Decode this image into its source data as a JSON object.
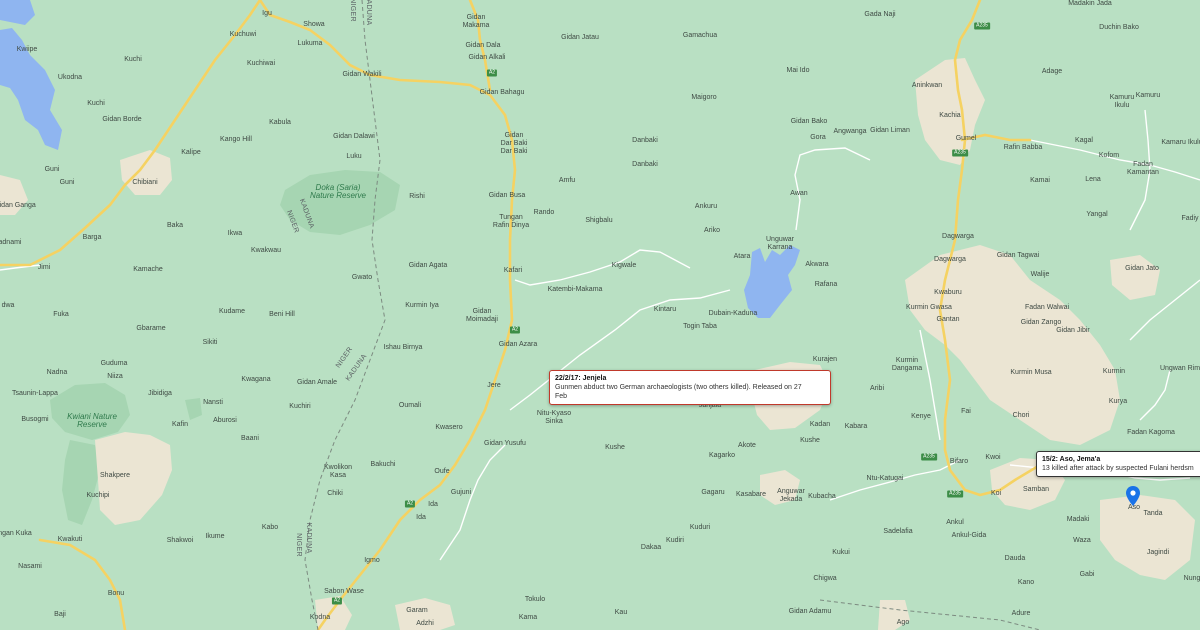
{
  "colors": {
    "land": "#b9e0c3",
    "forest": "#a6d5b2",
    "urban": "#ebe5d3",
    "water": "#8fb5f0",
    "highway": "#f5d262",
    "minor_road": "#ffffff",
    "accent": "#c0392b",
    "pin": "#1a73e8"
  },
  "places": [
    {
      "id": "showa",
      "name": "Showa"
    },
    {
      "id": "igu",
      "name": "Igu"
    },
    {
      "id": "lukuma",
      "name": "Lukuma"
    },
    {
      "id": "kuchuwi",
      "name": "Kuchuwi"
    },
    {
      "id": "kwiipe",
      "name": "Kwiipe"
    },
    {
      "id": "kuchi1",
      "name": "Kuchi"
    },
    {
      "id": "kuchiwai",
      "name": "Kuchiwai"
    },
    {
      "id": "gidan_wakili",
      "name": "Gidan Wakili"
    },
    {
      "id": "ukodna",
      "name": "Ukodna"
    },
    {
      "id": "kuchi2",
      "name": "Kuchi"
    },
    {
      "id": "gidan_borde",
      "name": "Gidan Borde"
    },
    {
      "id": "kabula",
      "name": "Kabula"
    },
    {
      "id": "kango_hill",
      "name": "Kango Hill"
    },
    {
      "id": "gidan_dalawi",
      "name": "Gidan Dalawi"
    },
    {
      "id": "kalipe",
      "name": "Kalipe"
    },
    {
      "id": "luku",
      "name": "Luku"
    },
    {
      "id": "chibiani",
      "name": "Chibiani"
    },
    {
      "id": "guni1",
      "name": "Guni"
    },
    {
      "id": "guni2",
      "name": "Guni"
    },
    {
      "id": "gidan_ganga",
      "name": "Gidan Ganga"
    },
    {
      "id": "rishi",
      "name": "Rishi"
    },
    {
      "id": "baka",
      "name": "Baka"
    },
    {
      "id": "barga",
      "name": "Barga"
    },
    {
      "id": "ikwa",
      "name": "Ikwa"
    },
    {
      "id": "adnami",
      "name": "adnami"
    },
    {
      "id": "kwakwau",
      "name": "Kwakwau"
    },
    {
      "id": "jimi",
      "name": "Jimi"
    },
    {
      "id": "kamache",
      "name": "Kamache"
    },
    {
      "id": "gwato",
      "name": "Gwato"
    },
    {
      "id": "gidan_agata",
      "name": "Gidan Agata"
    },
    {
      "id": "dwa",
      "name": "dwa"
    },
    {
      "id": "fuka",
      "name": "Fuka"
    },
    {
      "id": "kudame",
      "name": "Kudame"
    },
    {
      "id": "beni_hill",
      "name": "Beni Hill"
    },
    {
      "id": "kurmin_iya",
      "name": "Kurmin Iya"
    },
    {
      "id": "gbarame",
      "name": "Gbarame"
    },
    {
      "id": "sikiti",
      "name": "Sikiti"
    },
    {
      "id": "ishau_birnya",
      "name": "Ishau Birnya"
    },
    {
      "id": "guduma",
      "name": "Guduma"
    },
    {
      "id": "nadna",
      "name": "Nadna"
    },
    {
      "id": "niiza",
      "name": "Niiza"
    },
    {
      "id": "kwagana",
      "name": "Kwagana"
    },
    {
      "id": "gidan_amale",
      "name": "Gidan Amale"
    },
    {
      "id": "tsaunin_lappa",
      "name": "Tsaunin-Lappa"
    },
    {
      "id": "jibidiga",
      "name": "Jibidiga"
    },
    {
      "id": "nansti",
      "name": "Nansti"
    },
    {
      "id": "kuchiri",
      "name": "Kuchiri"
    },
    {
      "id": "oumali",
      "name": "Oumali"
    },
    {
      "id": "busogmi",
      "name": "Busogmi"
    },
    {
      "id": "aburosi",
      "name": "Aburosi"
    },
    {
      "id": "kafin",
      "name": "Kafin"
    },
    {
      "id": "baani",
      "name": "Baani"
    },
    {
      "id": "kwasero",
      "name": "Kwasero"
    },
    {
      "id": "shakpere",
      "name": "Shakpere"
    },
    {
      "id": "bakuchi",
      "name": "Bakuchi"
    },
    {
      "id": "kwolikon_kasa",
      "name": "Kwolikon\nKasa"
    },
    {
      "id": "kuchipi",
      "name": "Kuchipi"
    },
    {
      "id": "chiki",
      "name": "Chiki"
    },
    {
      "id": "kabo",
      "name": "Kabo"
    },
    {
      "id": "ikume",
      "name": "Ikume"
    },
    {
      "id": "shakwoi",
      "name": "Shakwoi"
    },
    {
      "id": "gidan_kuka",
      "name": "ngan Kuka"
    },
    {
      "id": "kwakuti",
      "name": "Kwakuti"
    },
    {
      "id": "nasami",
      "name": "Nasami"
    },
    {
      "id": "bonu",
      "name": "Bonu"
    },
    {
      "id": "baji",
      "name": "Baji"
    },
    {
      "id": "igmo",
      "name": "Igmo"
    },
    {
      "id": "sabon_wase",
      "name": "Sabon Wase"
    },
    {
      "id": "kodna",
      "name": "Kodna"
    },
    {
      "id": "garam",
      "name": "Garam"
    },
    {
      "id": "adzhi",
      "name": "Adzhi"
    },
    {
      "id": "gidan_makama",
      "name": "Gidan\nMakama"
    },
    {
      "id": "gidan_dala",
      "name": "Gidan Dala"
    },
    {
      "id": "gidan_alkali",
      "name": "Gidan Alkali"
    },
    {
      "id": "gidan_bahagu",
      "name": "Gidan Bahagu"
    },
    {
      "id": "gidan_dar_baki",
      "name": "Gidan\nDar Baki\nDar Baki"
    },
    {
      "id": "gidan_busa",
      "name": "Gidan Busa"
    },
    {
      "id": "tungan_rafin_dinya",
      "name": "Tungan\nRafin Dinya"
    },
    {
      "id": "kafari",
      "name": "Kafari"
    },
    {
      "id": "gidan_moimadaji",
      "name": "Gidan\nMoimadaji"
    },
    {
      "id": "gidan_azara",
      "name": "Gidan Azara"
    },
    {
      "id": "jere",
      "name": "Jere"
    },
    {
      "id": "gidan_yusufu",
      "name": "Gidan Yusufu"
    },
    {
      "id": "oufe",
      "name": "Oufe"
    },
    {
      "id": "ida1",
      "name": "Ida"
    },
    {
      "id": "ida2",
      "name": "Ida"
    },
    {
      "id": "gujuni",
      "name": "Gujuni"
    },
    {
      "id": "gidan_jatau",
      "name": "Gidan Jatau"
    },
    {
      "id": "gamachua",
      "name": "Gamachua"
    },
    {
      "id": "mai_ido",
      "name": "Mai Ido"
    },
    {
      "id": "maigoro",
      "name": "Maigoro"
    },
    {
      "id": "danbaki1",
      "name": "Danbaki"
    },
    {
      "id": "danbaki2",
      "name": "Danbaki"
    },
    {
      "id": "amfu",
      "name": "Amfu"
    },
    {
      "id": "rando",
      "name": "Rando"
    },
    {
      "id": "shigbalu",
      "name": "Shigbalu"
    },
    {
      "id": "kigwale",
      "name": "Kigwale"
    },
    {
      "id": "katembi_makama",
      "name": "Katembi-Makama"
    },
    {
      "id": "kintaru",
      "name": "Kintaru"
    },
    {
      "id": "togin_taba",
      "name": "Togin Taba"
    },
    {
      "id": "dubain_kaduna",
      "name": "Dubain-Kaduna"
    },
    {
      "id": "ankuru",
      "name": "Ankuru"
    },
    {
      "id": "ariko",
      "name": "Ariko"
    },
    {
      "id": "awan",
      "name": "Awan"
    },
    {
      "id": "gidan_bako",
      "name": "Gidan Bako"
    },
    {
      "id": "gora",
      "name": "Gora"
    },
    {
      "id": "angwanga",
      "name": "Angwanga"
    },
    {
      "id": "gidan_liman",
      "name": "Gidan Liman"
    },
    {
      "id": "gada_naji",
      "name": "Gada Naji"
    },
    {
      "id": "unguwar_karrana",
      "name": "Unguwar\nKarrana"
    },
    {
      "id": "atara",
      "name": "Atara"
    },
    {
      "id": "akwara",
      "name": "Akwara"
    },
    {
      "id": "rafana",
      "name": "Rafana"
    },
    {
      "id": "nitu_kyaso_sinka",
      "name": "Nitu-Kyaso\nSinka"
    },
    {
      "id": "janjala",
      "name": "Janjala"
    },
    {
      "id": "kushe1",
      "name": "Kushe"
    },
    {
      "id": "akote",
      "name": "Akote"
    },
    {
      "id": "kagarko",
      "name": "Kagarko"
    },
    {
      "id": "kushe2",
      "name": "Kushe"
    },
    {
      "id": "kadan",
      "name": "Kadan"
    },
    {
      "id": "kabara",
      "name": "Kabara"
    },
    {
      "id": "kurajen",
      "name": "Kurajen"
    },
    {
      "id": "aribi",
      "name": "Aribi"
    },
    {
      "id": "gagaru",
      "name": "Gagaru"
    },
    {
      "id": "kasabare",
      "name": "Kasabare"
    },
    {
      "id": "anguwar_jekada",
      "name": "Anguwar\nJekada"
    },
    {
      "id": "kubacha",
      "name": "Kubacha"
    },
    {
      "id": "ntu_katugai",
      "name": "Ntu-Katugai"
    },
    {
      "id": "kuduri",
      "name": "Kuduri"
    },
    {
      "id": "kudiri",
      "name": "Kudiri"
    },
    {
      "id": "dakaa",
      "name": "Dakaa"
    },
    {
      "id": "kukui",
      "name": "Kukui"
    },
    {
      "id": "chigwa",
      "name": "Chigwa"
    },
    {
      "id": "tokulo",
      "name": "Tokulo"
    },
    {
      "id": "kau",
      "name": "Kau"
    },
    {
      "id": "kama",
      "name": "Kama"
    },
    {
      "id": "gidan_adamu",
      "name": "Gidan Adamu"
    },
    {
      "id": "ago",
      "name": "Ago"
    },
    {
      "id": "madakin_jada",
      "name": "Madakin Jada"
    },
    {
      "id": "duchin_bako",
      "name": "Duchin Bako"
    },
    {
      "id": "adage",
      "name": "Adage"
    },
    {
      "id": "aninkwan",
      "name": "Aninkwan"
    },
    {
      "id": "kachia",
      "name": "Kachia"
    },
    {
      "id": "gumel",
      "name": "Gumel"
    },
    {
      "id": "kamuru_ikulu",
      "name": "Kamuru\nIkulu"
    },
    {
      "id": "kamuru",
      "name": "Kamuru"
    },
    {
      "id": "kamaru_ikulu2",
      "name": "Kamaru Ikulu"
    },
    {
      "id": "kagal",
      "name": "Kagal"
    },
    {
      "id": "rafin_babba",
      "name": "Rafin Babba"
    },
    {
      "id": "kofom",
      "name": "Kofom"
    },
    {
      "id": "fadan_kamantan",
      "name": "Fadan\nKamantan"
    },
    {
      "id": "kamai",
      "name": "Kamai"
    },
    {
      "id": "lena",
      "name": "Lena"
    },
    {
      "id": "fadiy",
      "name": "Fadiy"
    },
    {
      "id": "yangal",
      "name": "Yangal"
    },
    {
      "id": "dagwarga1",
      "name": "Dagwarga"
    },
    {
      "id": "dagwarga2",
      "name": "Dagwarga"
    },
    {
      "id": "gidan_tagwai",
      "name": "Gidan Tagwai"
    },
    {
      "id": "gidan_jato",
      "name": "Gidan Jato"
    },
    {
      "id": "walije",
      "name": "Walije"
    },
    {
      "id": "kwaburu",
      "name": "Kwaburu"
    },
    {
      "id": "kurmin_gwasa",
      "name": "Kurmin Gwasa"
    },
    {
      "id": "gantan",
      "name": "Gantan"
    },
    {
      "id": "fadan_walwai",
      "name": "Fadan Walwai"
    },
    {
      "id": "gidan_zango",
      "name": "Gidan Zango"
    },
    {
      "id": "gidan_jibir",
      "name": "Gidan Jibir"
    },
    {
      "id": "kurmin_dangama",
      "name": "Kurmin\nDangama"
    },
    {
      "id": "kurmin_musa",
      "name": "Kurmin Musa"
    },
    {
      "id": "kurmin",
      "name": "Kurmin"
    },
    {
      "id": "ungwan_rimi",
      "name": "Ungwan Rim"
    },
    {
      "id": "kenye",
      "name": "Kenye"
    },
    {
      "id": "fai",
      "name": "Fai"
    },
    {
      "id": "chori",
      "name": "Chori"
    },
    {
      "id": "kurya",
      "name": "Kurya"
    },
    {
      "id": "fadan_kagoma",
      "name": "Fadan Kagoma"
    },
    {
      "id": "bifaro",
      "name": "Bifaro"
    },
    {
      "id": "kwoi1",
      "name": "Kwoi"
    },
    {
      "id": "kwoi2",
      "name": "Koi"
    },
    {
      "id": "samban",
      "name": "Samban"
    },
    {
      "id": "aso",
      "name": "Aso"
    },
    {
      "id": "tanda",
      "name": "Tanda"
    },
    {
      "id": "madaki",
      "name": "Madaki"
    },
    {
      "id": "ankul",
      "name": "Ankul"
    },
    {
      "id": "ankul_gida",
      "name": "Ankul-Gida"
    },
    {
      "id": "sadelafia",
      "name": "Sadelafia"
    },
    {
      "id": "waza",
      "name": "Waza"
    },
    {
      "id": "jagindi",
      "name": "Jagindi"
    },
    {
      "id": "dauda",
      "name": "Dauda"
    },
    {
      "id": "gabi",
      "name": "Gabi"
    },
    {
      "id": "nungu",
      "name": "Nung"
    },
    {
      "id": "kano",
      "name": "Kano"
    },
    {
      "id": "adure",
      "name": "Adure"
    }
  ],
  "parks": [
    {
      "id": "doka",
      "name": "Doka (Saria)\nNature Reserve"
    },
    {
      "id": "kwiani",
      "name": "Kwiani Nature\nReserve"
    }
  ],
  "borders": [
    {
      "id": "b1",
      "name": "KADUNA"
    },
    {
      "id": "b2",
      "name": "NIGER"
    },
    {
      "id": "b3",
      "name": "KADUNA"
    },
    {
      "id": "b4",
      "name": "NIGER"
    },
    {
      "id": "b5",
      "name": "NIGER"
    },
    {
      "id": "b6",
      "name": "KADUNA"
    },
    {
      "id": "b7",
      "name": "KADUNA"
    },
    {
      "id": "b8",
      "name": "NIGER"
    }
  ],
  "road_shields": [
    {
      "id": "s1",
      "label": "A2"
    },
    {
      "id": "s2",
      "label": "A2"
    },
    {
      "id": "s3",
      "label": "A2"
    },
    {
      "id": "s4",
      "label": "A2"
    },
    {
      "id": "s5",
      "label": "A235"
    },
    {
      "id": "s6",
      "label": "A235"
    },
    {
      "id": "s7",
      "label": "A235"
    },
    {
      "id": "s8",
      "label": "A235"
    }
  ],
  "incidents": [
    {
      "id": "jenjela",
      "title": "22/2/17: Jenjela",
      "text": "Gunmen abduct two German archaeologists (two others killed). Released on 27\nFeb"
    },
    {
      "id": "aso",
      "title": "15/2: Aso, Jema'a",
      "text": "13 killed after attack by suspected Fulani herdsm"
    }
  ],
  "markers": [
    {
      "id": "aso_pin",
      "icon": "map-pin-icon"
    }
  ]
}
